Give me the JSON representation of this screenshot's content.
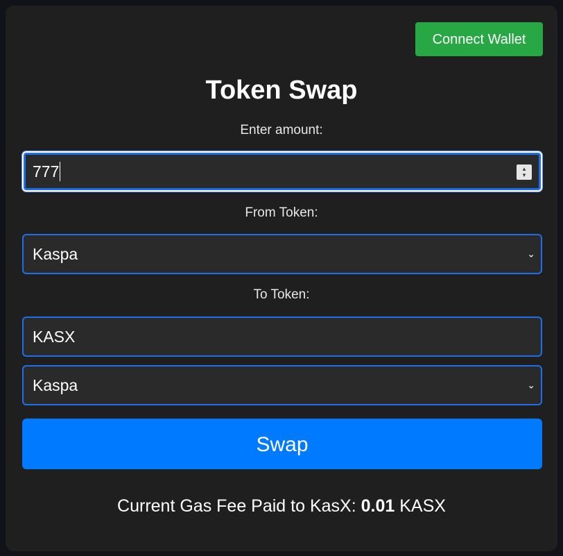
{
  "header": {
    "connect_wallet_label": "Connect Wallet",
    "title": "Token Swap"
  },
  "form": {
    "amount_label": "Enter amount:",
    "amount_value": "777",
    "from_label": "From Token:",
    "from_selected": "Kaspa",
    "to_label": "To Token:",
    "to_token_value": "KASX",
    "to_selected": "Kaspa",
    "swap_label": "Swap"
  },
  "footer": {
    "gas_prefix": "Current Gas Fee Paid to KasX: ",
    "gas_value": "0.01",
    "gas_suffix": " KASX"
  },
  "colors": {
    "background": "#1f1f1f",
    "connect_wallet": "#28a745",
    "swap_button": "#007bff",
    "field_border": "#1f6feb"
  },
  "icons": {
    "dropdown": "chevron-down-icon",
    "number_spinner": "spinner-icon"
  }
}
